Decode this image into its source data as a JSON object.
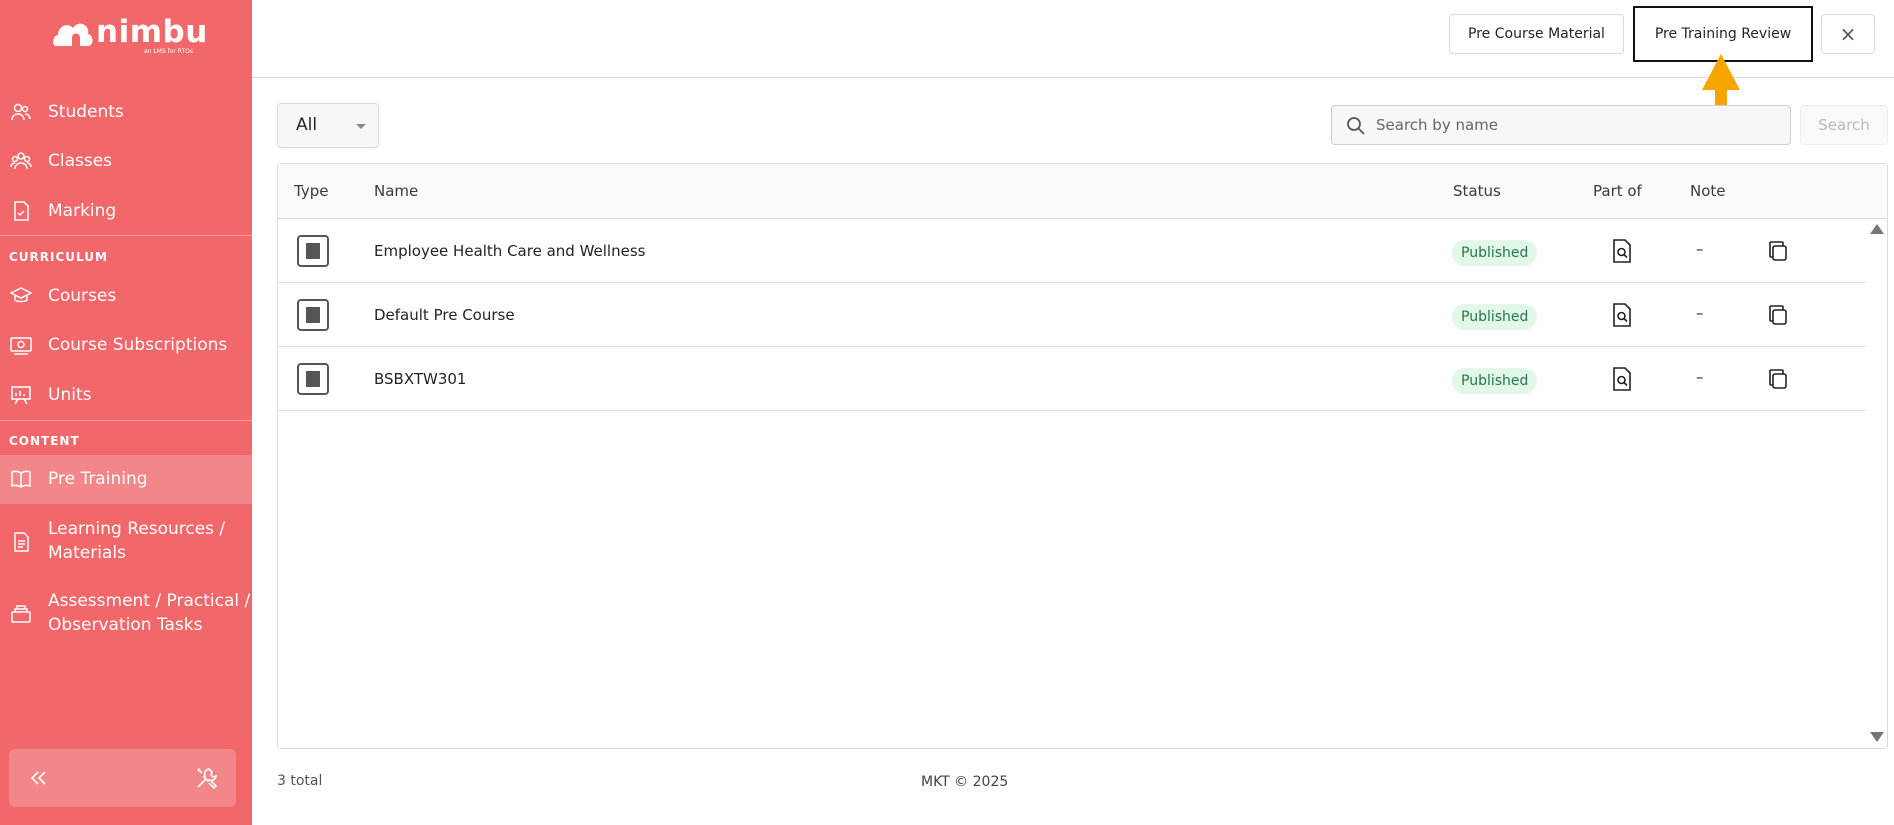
{
  "app": {
    "logo_text": "nimbu",
    "logo_subtitle": "an LMS for RTOs"
  },
  "sidebar": {
    "items": [
      {
        "label": "Students",
        "icon": "students-icon"
      },
      {
        "label": "Classes",
        "icon": "classes-icon"
      },
      {
        "label": "Marking",
        "icon": "marking-icon"
      }
    ],
    "curriculum_label": "CURRICULUM",
    "curriculum_items": [
      {
        "label": "Courses",
        "icon": "courses-icon"
      },
      {
        "label": "Course Subscriptions",
        "icon": "subscriptions-icon"
      },
      {
        "label": "Units",
        "icon": "units-icon"
      }
    ],
    "content_label": "CONTENT",
    "content_items": [
      {
        "label": "Pre Training",
        "icon": "book-icon",
        "active": true
      },
      {
        "label_line1": "Learning Resources /",
        "label_line2": "Materials",
        "icon": "document-icon"
      },
      {
        "label_line1": "Assessment / Practical /",
        "label_line2": "Observation Tasks",
        "icon": "tray-icon"
      }
    ]
  },
  "topbar": {
    "pre_course_material": "Pre Course Material",
    "pre_training_review": "Pre Training Review",
    "close": "×"
  },
  "filters": {
    "type_selected": "All",
    "search_placeholder": "Search by name",
    "search_button": "Search"
  },
  "table": {
    "headers": {
      "type": "Type",
      "name": "Name",
      "status": "Status",
      "part_of": "Part of",
      "note": "Note"
    },
    "rows": [
      {
        "name": "Employee Health Care and Wellness",
        "status": "Published",
        "note": "–"
      },
      {
        "name": "Default Pre Course",
        "status": "Published",
        "note": "–"
      },
      {
        "name": "BSBXTW301",
        "status": "Published",
        "note": "–"
      }
    ]
  },
  "footer": {
    "total": "3 total",
    "copyright": "MKT © 2025"
  },
  "colors": {
    "sidebar": "#f1676a",
    "sidebar_active": "#f38689",
    "badge_bg": "#e3f6ea",
    "badge_text": "#1f7a45",
    "arrow": "#f5a400"
  }
}
